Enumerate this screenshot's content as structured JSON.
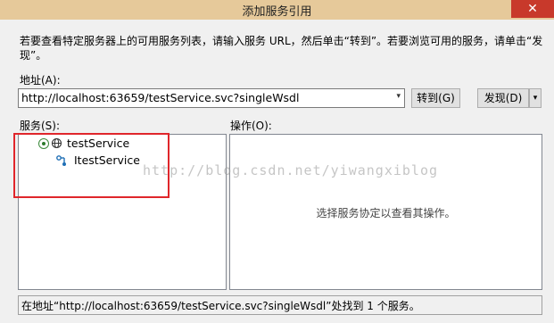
{
  "window": {
    "title": "添加服务引用",
    "close_glyph": "✕"
  },
  "description": "若要查看特定服务器上的可用服务列表，请输入服务 URL，然后单击“转到”。若要浏览可用的服务，请单击“发现”。",
  "address": {
    "label": "地址(A):",
    "value": "http://localhost:63659/testService.svc?singleWsdl",
    "go_label": "转到(G)",
    "discover_label": "发现(D)",
    "dropdown_glyph": "▾"
  },
  "services": {
    "label": "服务(S):",
    "tree": [
      {
        "label": "testService",
        "icon": "globe-icon"
      },
      {
        "label": "ItestService",
        "icon": "interface-icon"
      }
    ]
  },
  "operations": {
    "label": "操作(O):",
    "hint": "选择服务协定以查看其操作。"
  },
  "status": "在地址“http://localhost:63659/testService.svc?singleWsdl”处找到 1 个服务。",
  "watermark": "http://blog.csdn.net/yiwangxiblog",
  "colors": {
    "titlebar": "#e6c99a",
    "close_button": "#c8392b",
    "highlight_box": "#e0262b"
  }
}
